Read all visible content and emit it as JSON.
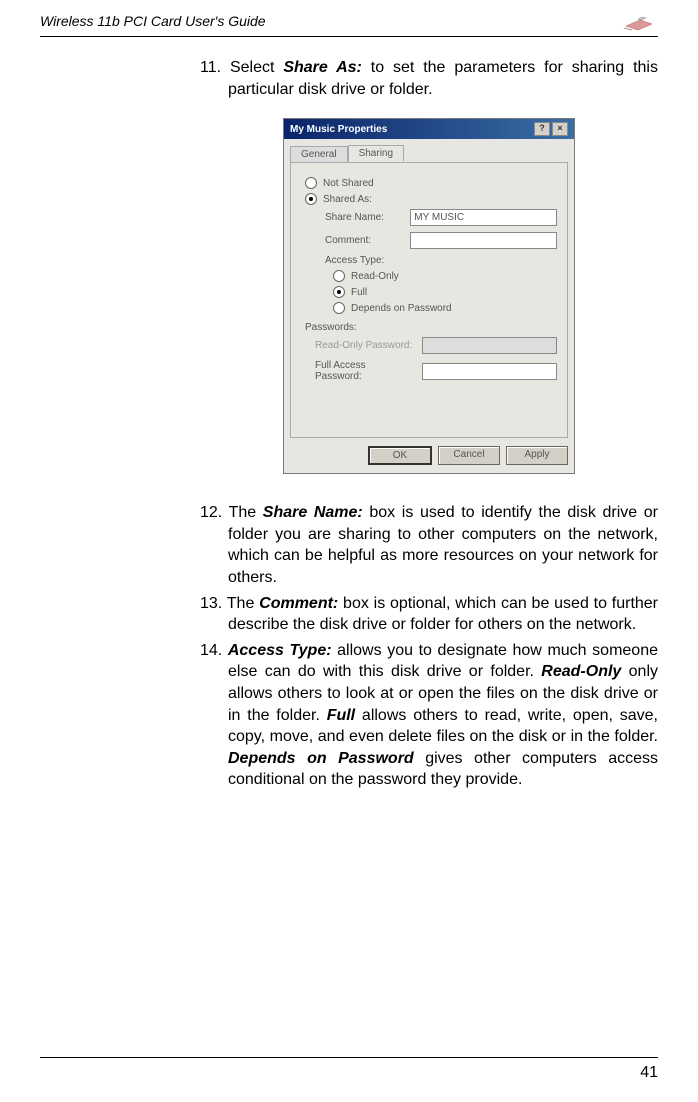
{
  "header": {
    "title": "Wireless 11b PCI Card User's Guide"
  },
  "steps": {
    "s11": {
      "number": "11.",
      "prefix": "Select ",
      "term": "Share As:",
      "suffix": " to set the parameters for sharing this particular disk drive or folder."
    },
    "s12": {
      "number": "12.",
      "prefix": "The ",
      "term": "Share Name:",
      "suffix": " box is used to identify the disk drive or folder you are sharing to other computers on the network, which can be helpful as more resources on your network for others."
    },
    "s13": {
      "number": "13.",
      "prefix": "The ",
      "term": "Comment:",
      "suffix": " box is optional, which can be used to further describe the disk drive or folder for others on the network."
    },
    "s14": {
      "number": "14.",
      "term": "Access Type:",
      "part1": " allows you to designate how much someone else can do with this disk drive or folder. ",
      "term2": "Read-Only",
      "part2": " only allows others to look at or open the files on the disk drive or in the folder. ",
      "term3": "Full",
      "part3": " allows others to read, write, open, save, copy, move, and even delete files on the disk or in the folder. ",
      "term4": "Depends on Password",
      "part4": " gives other computers access conditional on the password they provide."
    }
  },
  "dialog": {
    "title": "My Music Properties",
    "tabs": {
      "general": "General",
      "sharing": "Sharing"
    },
    "not_shared": "Not Shared",
    "shared_as": "Shared As:",
    "share_name_label": "Share Name:",
    "share_name_value": "MY MUSIC",
    "comment_label": "Comment:",
    "access_type": "Access Type:",
    "read_only": "Read-Only",
    "full": "Full",
    "depends": "Depends on Password",
    "passwords": "Passwords:",
    "read_only_pw": "Read-Only Password:",
    "full_pw": "Full Access Password:",
    "ok": "OK",
    "cancel": "Cancel",
    "apply": "Apply"
  },
  "footer": {
    "page": "41"
  }
}
